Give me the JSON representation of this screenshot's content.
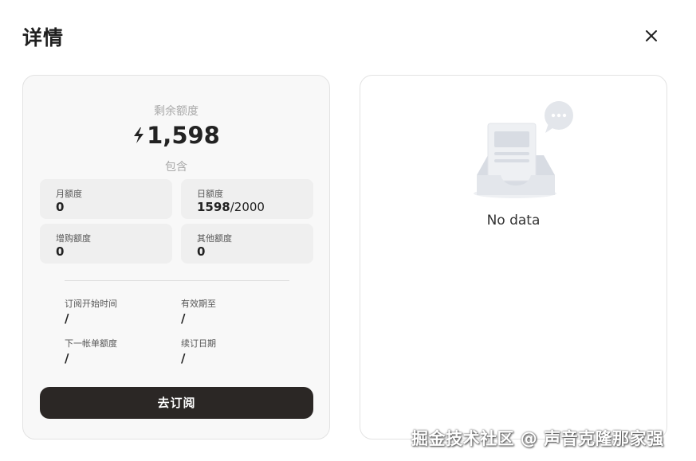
{
  "header": {
    "title": "详情",
    "close_icon": "close-icon"
  },
  "quota": {
    "remaining_label": "剩余额度",
    "remaining_icon": "lightning-bolt-icon",
    "remaining_value": "1,598",
    "include_label": "包含",
    "monthly": {
      "label": "月额度",
      "value": "0"
    },
    "daily": {
      "label": "日额度",
      "used": "1598",
      "total": "/2000"
    },
    "purchased": {
      "label": "增购额度",
      "value": "0"
    },
    "other": {
      "label": "其他额度",
      "value": "0"
    }
  },
  "subscription": {
    "start_time_label": "订阅开始时间",
    "start_time_value": "/",
    "valid_until_label": "有效期至",
    "valid_until_value": "/",
    "next_bill_label": "下一帐单额度",
    "next_bill_value": "/",
    "renewal_date_label": "续订日期",
    "renewal_date_value": "/"
  },
  "actions": {
    "subscribe_label": "去订阅"
  },
  "details_panel": {
    "empty_icon": "empty-inbox-icon",
    "empty_text": "No data"
  },
  "watermark": "掘金技术社区 @ 声音克隆那家强",
  "colors": {
    "button_bg": "#2b2725",
    "panel_bg": "#f8f8f8",
    "cell_bg": "#efefef"
  }
}
